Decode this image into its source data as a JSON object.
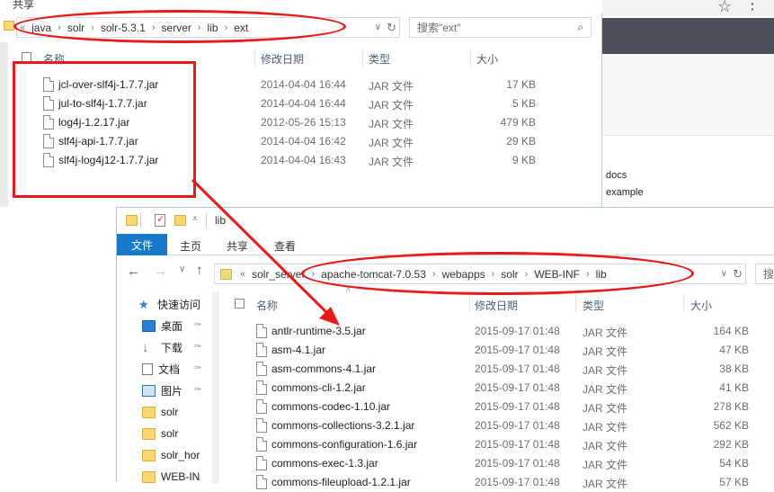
{
  "window1": {
    "menu_label": "共享",
    "address_segments": [
      "java",
      "solr",
      "solr-5.3.1",
      "server",
      "lib",
      "ext"
    ],
    "search_placeholder": "搜索\"ext\"",
    "columns": {
      "name": "名称",
      "date": "修改日期",
      "type": "类型",
      "size": "大小"
    },
    "files": [
      {
        "name": "jcl-over-slf4j-1.7.7.jar",
        "date": "2014-04-04 16:44",
        "type": "JAR 文件",
        "size": "17 KB"
      },
      {
        "name": "jul-to-slf4j-1.7.7.jar",
        "date": "2014-04-04 16:44",
        "type": "JAR 文件",
        "size": "5 KB"
      },
      {
        "name": "log4j-1.2.17.jar",
        "date": "2012-05-26 15:13",
        "type": "JAR 文件",
        "size": "479 KB"
      },
      {
        "name": "slf4j-api-1.7.7.jar",
        "date": "2014-04-04 16:42",
        "type": "JAR 文件",
        "size": "29 KB"
      },
      {
        "name": "slf4j-log4j12-1.7.7.jar",
        "date": "2014-04-04 16:43",
        "type": "JAR 文件",
        "size": "9 KB"
      }
    ]
  },
  "browser_links": [
    "docs",
    "example"
  ],
  "window2": {
    "title": "lib",
    "ribbon_tabs": {
      "file": "文件",
      "home": "主页",
      "share": "共享",
      "view": "查看"
    },
    "address_segments": [
      "solr_server",
      "apache-tomcat-7.0.53",
      "webapps",
      "solr",
      "WEB-INF",
      "lib"
    ],
    "search_placeholder": "搜",
    "columns": {
      "name": "名称",
      "date": "修改日期",
      "type": "类型",
      "size": "大小"
    },
    "nav_items": [
      {
        "label": "快速访问",
        "icon": "star-icon"
      },
      {
        "label": "桌面",
        "icon": "desktop-icon",
        "pinned": true
      },
      {
        "label": "下载",
        "icon": "download-icon",
        "pinned": true
      },
      {
        "label": "文档",
        "icon": "document-icon",
        "pinned": true
      },
      {
        "label": "图片",
        "icon": "picture-icon",
        "pinned": true
      },
      {
        "label": "solr",
        "icon": "folder-icon"
      },
      {
        "label": "solr",
        "icon": "folder-icon"
      },
      {
        "label": "solr_hor",
        "icon": "folder-icon"
      },
      {
        "label": "WEB-IN",
        "icon": "folder-icon"
      }
    ],
    "files": [
      {
        "name": "antlr-runtime-3.5.jar",
        "date": "2015-09-17 01:48",
        "type": "JAR 文件",
        "size": "164 KB"
      },
      {
        "name": "asm-4.1.jar",
        "date": "2015-09-17 01:48",
        "type": "JAR 文件",
        "size": "47 KB"
      },
      {
        "name": "asm-commons-4.1.jar",
        "date": "2015-09-17 01:48",
        "type": "JAR 文件",
        "size": "38 KB"
      },
      {
        "name": "commons-cli-1.2.jar",
        "date": "2015-09-17 01:48",
        "type": "JAR 文件",
        "size": "41 KB"
      },
      {
        "name": "commons-codec-1.10.jar",
        "date": "2015-09-17 01:48",
        "type": "JAR 文件",
        "size": "278 KB"
      },
      {
        "name": "commons-collections-3.2.1.jar",
        "date": "2015-09-17 01:48",
        "type": "JAR 文件",
        "size": "562 KB"
      },
      {
        "name": "commons-configuration-1.6.jar",
        "date": "2015-09-17 01:48",
        "type": "JAR 文件",
        "size": "292 KB"
      },
      {
        "name": "commons-exec-1.3.jar",
        "date": "2015-09-17 01:48",
        "type": "JAR 文件",
        "size": "54 KB"
      },
      {
        "name": "commons-fileupload-1.2.1.jar",
        "date": "2015-09-17 01:48",
        "type": "JAR 文件",
        "size": "57 KB"
      }
    ]
  },
  "colors": {
    "annotation_red": "#e81a1a",
    "ribbon_blue": "#1979ca",
    "header_text": "#4c607a"
  }
}
